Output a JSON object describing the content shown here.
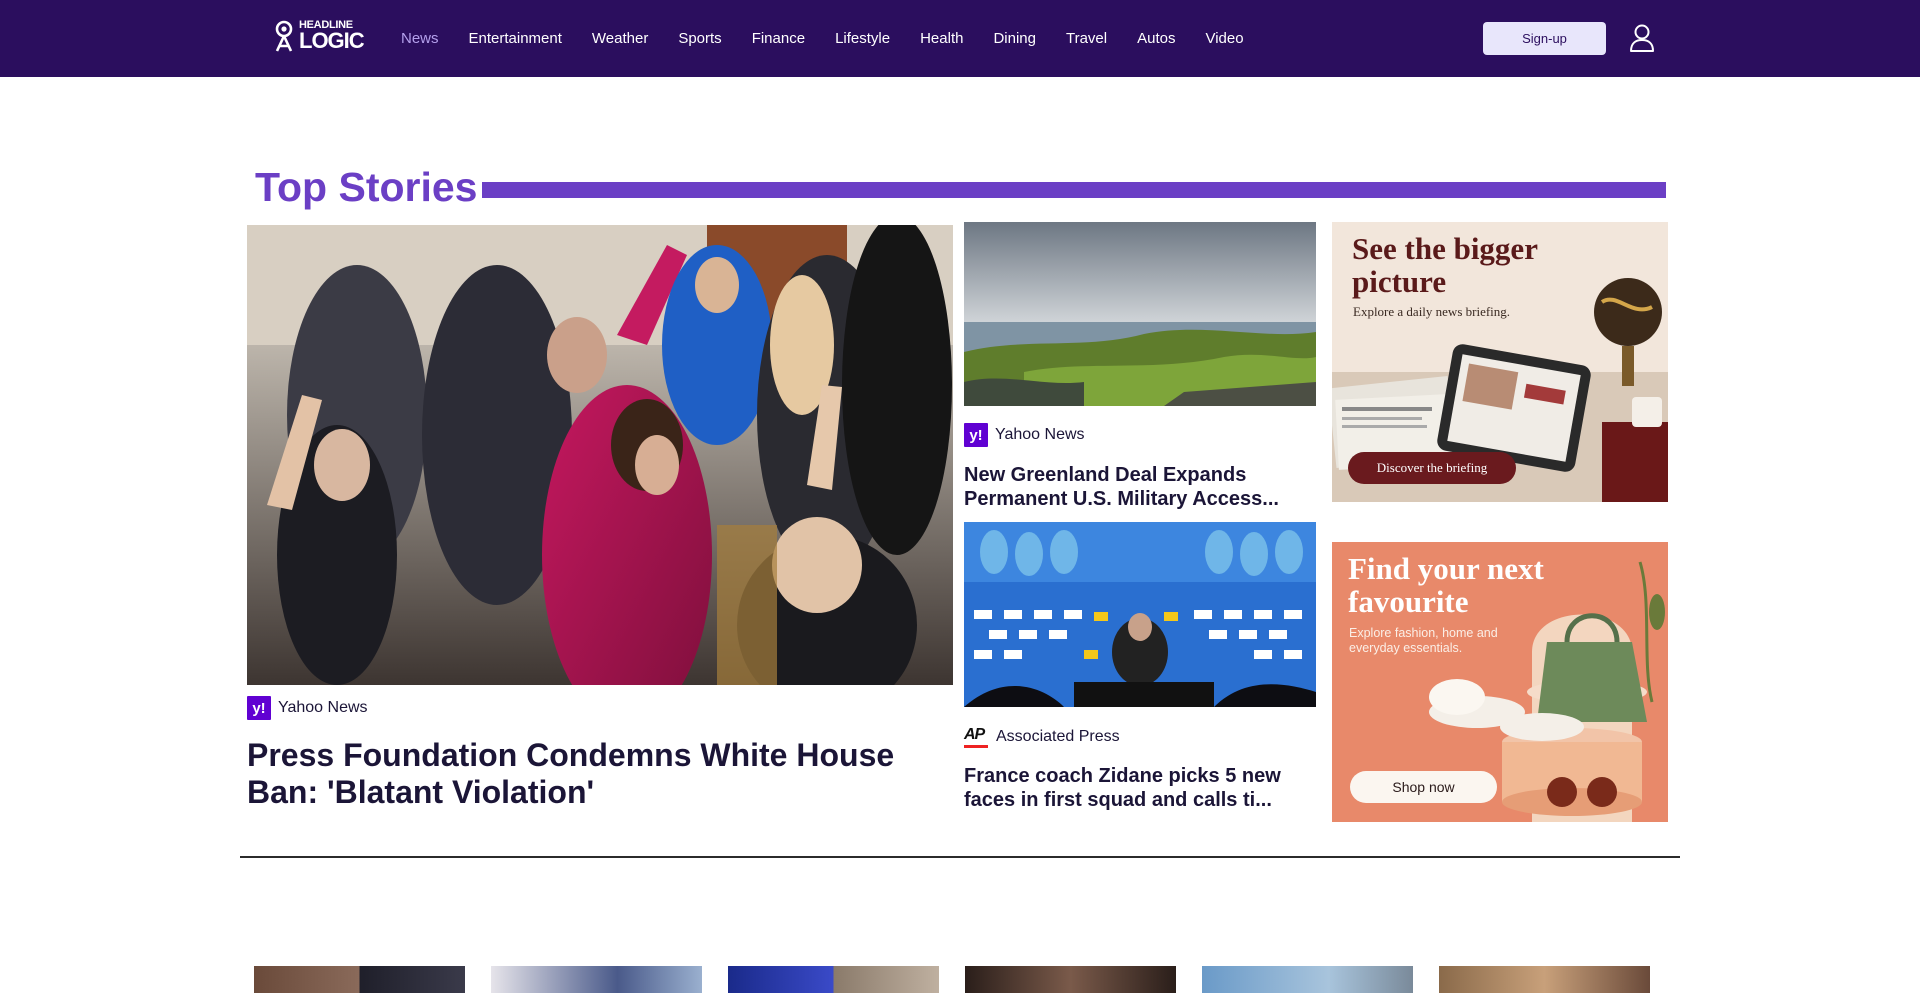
{
  "header": {
    "logo": {
      "line1": "HEADLINE",
      "line2": "LOGIC"
    },
    "nav": [
      {
        "label": "News",
        "active": true
      },
      {
        "label": "Entertainment"
      },
      {
        "label": "Weather"
      },
      {
        "label": "Sports"
      },
      {
        "label": "Finance"
      },
      {
        "label": "Lifestyle"
      },
      {
        "label": "Health"
      },
      {
        "label": "Dining"
      },
      {
        "label": "Travel"
      },
      {
        "label": "Autos"
      },
      {
        "label": "Video"
      }
    ],
    "signup_label": "Sign-up",
    "user_icon": "user-icon"
  },
  "top_stories": {
    "title": "Top Stories",
    "main": {
      "source": "Yahoo News",
      "source_icon": "y!",
      "headline": "Press Foundation Condemns White House Ban: 'Blatant Violation'"
    },
    "side": [
      {
        "source": "Yahoo News",
        "source_icon": "y!",
        "headline": "New Greenland Deal Expands Permanent U.S. Military Access..."
      },
      {
        "source": "Associated Press",
        "source_icon": "AP",
        "headline": "France coach Zidane picks 5 new faces in first squad and calls ti..."
      }
    ]
  },
  "ads": [
    {
      "title": "See the bigger picture",
      "subtitle": "Explore a daily news briefing.",
      "button": "Discover the briefing"
    },
    {
      "title": "Find your next favourite",
      "subtitle": "Explore fashion, home and everyday essentials.",
      "button": "Shop now"
    }
  ],
  "colors": {
    "header_bg": "#2b0e5e",
    "accent": "#6b3fc5",
    "nav_active": "#b4a0ec",
    "signup_bg": "#e8e6fb",
    "yahoo_purple": "#6001d2"
  }
}
